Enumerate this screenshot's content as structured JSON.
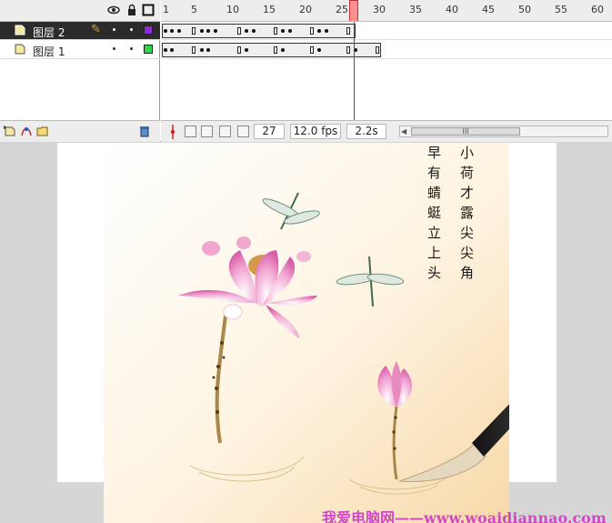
{
  "timeline": {
    "header_icons": [
      "eye-icon",
      "lock-icon",
      "outline-icon"
    ],
    "ruler_ticks": [
      "1",
      "5",
      "10",
      "15",
      "20",
      "25",
      "30",
      "35",
      "40",
      "45",
      "50",
      "55",
      "60"
    ],
    "layers": [
      {
        "name": "图层 2",
        "selected": true,
        "outline_color": "#8a2bd6"
      },
      {
        "name": "图层 1",
        "selected": false,
        "outline_color": "#33d64a"
      }
    ],
    "current_frame": "27",
    "frame_rate": "12.0 fps",
    "elapsed_time": "2.2s",
    "scroll_thumb_glyph": "III"
  },
  "artwork": {
    "poem_columns": [
      "小荷才露尖尖角",
      "早有蜻蜓立上头"
    ]
  },
  "watermark": "我爱电脑网——www.woaidiannao.com",
  "colors": {
    "selected_layer_bg": "#2b2b2b",
    "playhead": "#d02020",
    "stage_bg": "#ffffff",
    "workspace_bg": "#d6d6d6",
    "watermark": "#d246c8"
  }
}
